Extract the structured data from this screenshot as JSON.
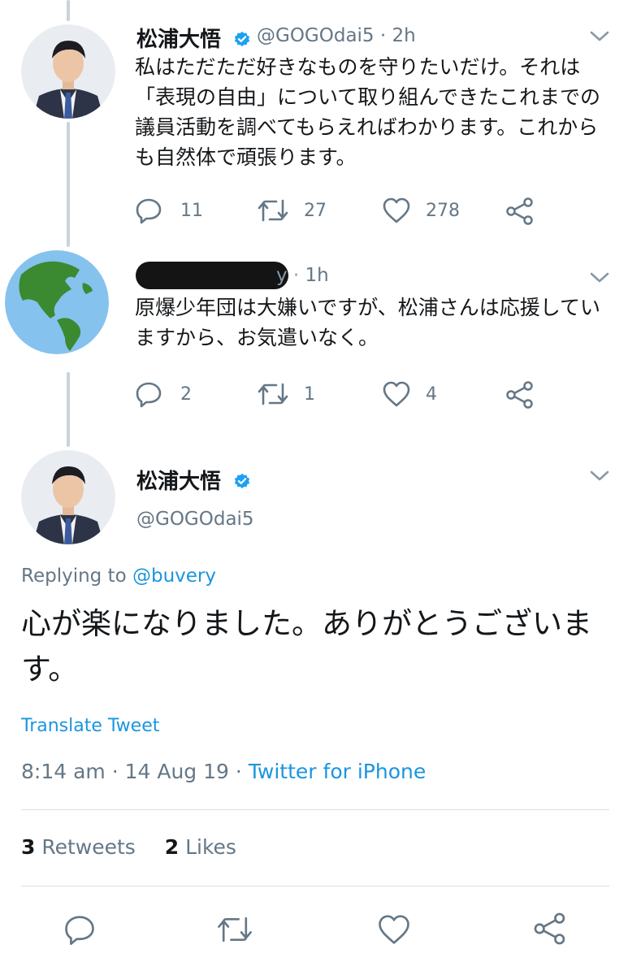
{
  "tweet1": {
    "name": "松浦大悟",
    "handle": "@GOGOdai5",
    "time": "2h",
    "text": "私はただただ好きなものを守りたいだけ。それは「表現の自由」について取り組んできたこれまでの議員活動を調べてもらえればわかります。これからも自然体で頑張ります。",
    "replies": "11",
    "retweets": "27",
    "likes": "278"
  },
  "tweet2": {
    "time": "1h",
    "text": "原爆少年団は大嫌いですが、松浦さんは応援していますから、お気遣いなく。",
    "replies": "2",
    "retweets": "1",
    "likes": "4"
  },
  "main": {
    "name": "松浦大悟",
    "handle": "@GOGOdai5",
    "replying_prefix": "Replying to",
    "replying_to": "@buvery",
    "text": "心が楽になりました。ありがとうございます。",
    "translate": "Translate Tweet",
    "timestamp": "8:14 am · 14 Aug 19 · ",
    "source": "Twitter for iPhone",
    "retweet_count": "3",
    "retweet_label": "Retweets",
    "like_count": "2",
    "like_label": "Likes"
  },
  "colors": {
    "accent": "#1b95e0",
    "muted": "#657786",
    "thread": "#c9d3db"
  },
  "icons": {
    "reply": "reply-icon",
    "retweet": "retweet-icon",
    "like": "heart-icon",
    "share": "share-icon",
    "verified": "verified-badge-icon",
    "more": "chevron-down-icon"
  }
}
